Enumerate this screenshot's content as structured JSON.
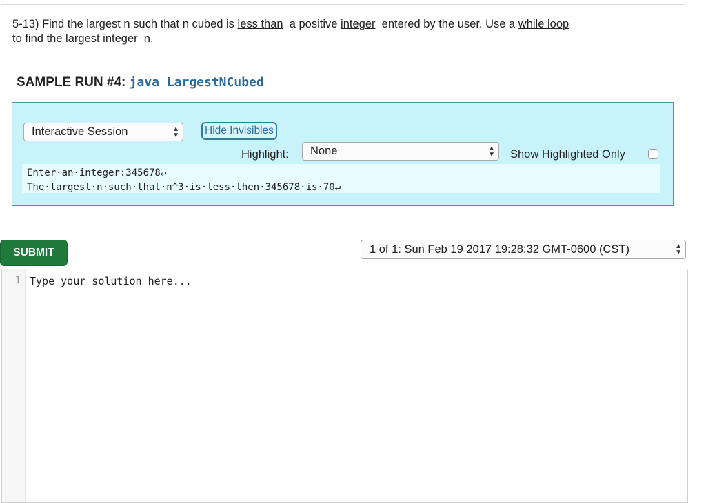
{
  "problem": {
    "prefix": "5-13) Find the largest n such that n cubed is ",
    "link_less_than": "less than",
    "middle1": "  a positive ",
    "link_integer1": "integer",
    "middle2": "  entered by the user. Use a ",
    "link_while_loop": "while loop",
    "line2_prefix": "to find the largest ",
    "link_integer2": "integer",
    "suffix": "  n."
  },
  "sample_run": {
    "label": "SAMPLE RUN #4:",
    "command": "java LargestNCubed"
  },
  "session": {
    "mode_select": "Interactive Session",
    "hide_invisibles_label": "Hide Invisibles",
    "highlight_label": "Highlight:",
    "highlight_select": "None",
    "show_highlighted_label": "Show Highlighted Only",
    "show_highlighted_checked": false,
    "console_lines": [
      "Enter·an·integer:345678↵",
      "The·largest·n·such·that·n^3·is·less·then·345678·is·70↵"
    ]
  },
  "submit_label": "SUBMIT",
  "version_select": "1 of 1: Sun Feb 19 2017 19:28:32 GMT-0600 (CST)",
  "editor": {
    "line_number": "1",
    "placeholder_text": "Type your solution here..."
  },
  "colors": {
    "session_bg": "#c9f3fb",
    "session_border": "#4f95a8",
    "command_blue": "#2c6a9a",
    "submit_green": "#1f7a3b"
  },
  "icons": [
    "select-arrows-icon",
    "return-arrow-icon"
  ]
}
